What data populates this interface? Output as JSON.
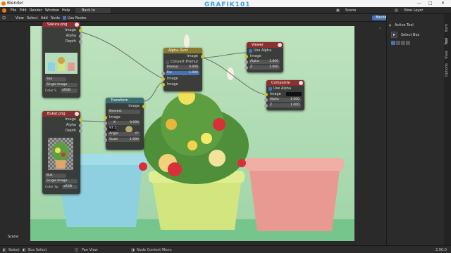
{
  "window": {
    "title": "Blender"
  },
  "menu": [
    "File",
    "Edit",
    "Render",
    "Window",
    "Help"
  ],
  "back_button": "Back to Previous",
  "watermark": "GRAFIK101",
  "topright": {
    "scene": "Scene",
    "view_layer": "View Layer"
  },
  "header": {
    "items": [
      "View",
      "Select",
      "Add",
      "Node"
    ],
    "use_nodes": "Use Nodes",
    "backdrop": "Backdrop"
  },
  "sidebar": {
    "title": "Active Tool",
    "tool": "Select Box",
    "tabs": [
      "Item",
      "Tool",
      "View",
      "Options"
    ]
  },
  "nodes": {
    "sakura": {
      "title": "Sakura.png",
      "outputs": [
        "Image",
        "Alpha",
        "Depth"
      ],
      "file": "Sak",
      "source": "Single Image",
      "color_space_label": "Color S",
      "color_space": "sRGB"
    },
    "bukat": {
      "title": "Bukat.png",
      "outputs": [
        "Image",
        "Alpha",
        "Depth"
      ],
      "file": "Buk",
      "source": "Single Image",
      "color_space_label": "Color Sp",
      "color_space": "sRGB"
    },
    "transform": {
      "title": "Transform",
      "output": "Image",
      "filter": "Nearest",
      "input": "Image",
      "x_label": "X",
      "x": "0.000",
      "y": "97.1",
      "angle_label": "Angle",
      "angle": "0°",
      "scale_label": "Scale",
      "scale": "1.000"
    },
    "alpha_over": {
      "title": "Alpha Over",
      "output": "Image",
      "convert": "Convert Premul",
      "premul_label": "Premul",
      "premul": "0.000",
      "fac_label": "Fac",
      "fac": "1.000",
      "inputs": [
        "Image",
        "Image"
      ]
    },
    "viewer": {
      "title": "Viewer",
      "use_alpha": "Use Alpha",
      "image": "Image",
      "alpha_label": "Alpha",
      "alpha": "1.000",
      "z_label": "Z",
      "z": "1.000"
    },
    "composite": {
      "title": "Composite",
      "use_alpha": "Use Alpha",
      "image": "Image",
      "alpha_label": "Alpha",
      "alpha": "1.000",
      "z_label": "Z",
      "z": "1.000"
    }
  },
  "scene_label": "Scene",
  "status": {
    "select": "Select",
    "box_select": "Box Select",
    "pan_view": "Pan View",
    "context_menu": "Node Context Menu",
    "version": "2.90.0"
  },
  "colors": {
    "image_node": "#8b2f2f",
    "transform_node": "#3a6e73",
    "mix_node": "#8a7a2d",
    "output_node": "#8b2f2f",
    "accent": "#4772b3"
  }
}
